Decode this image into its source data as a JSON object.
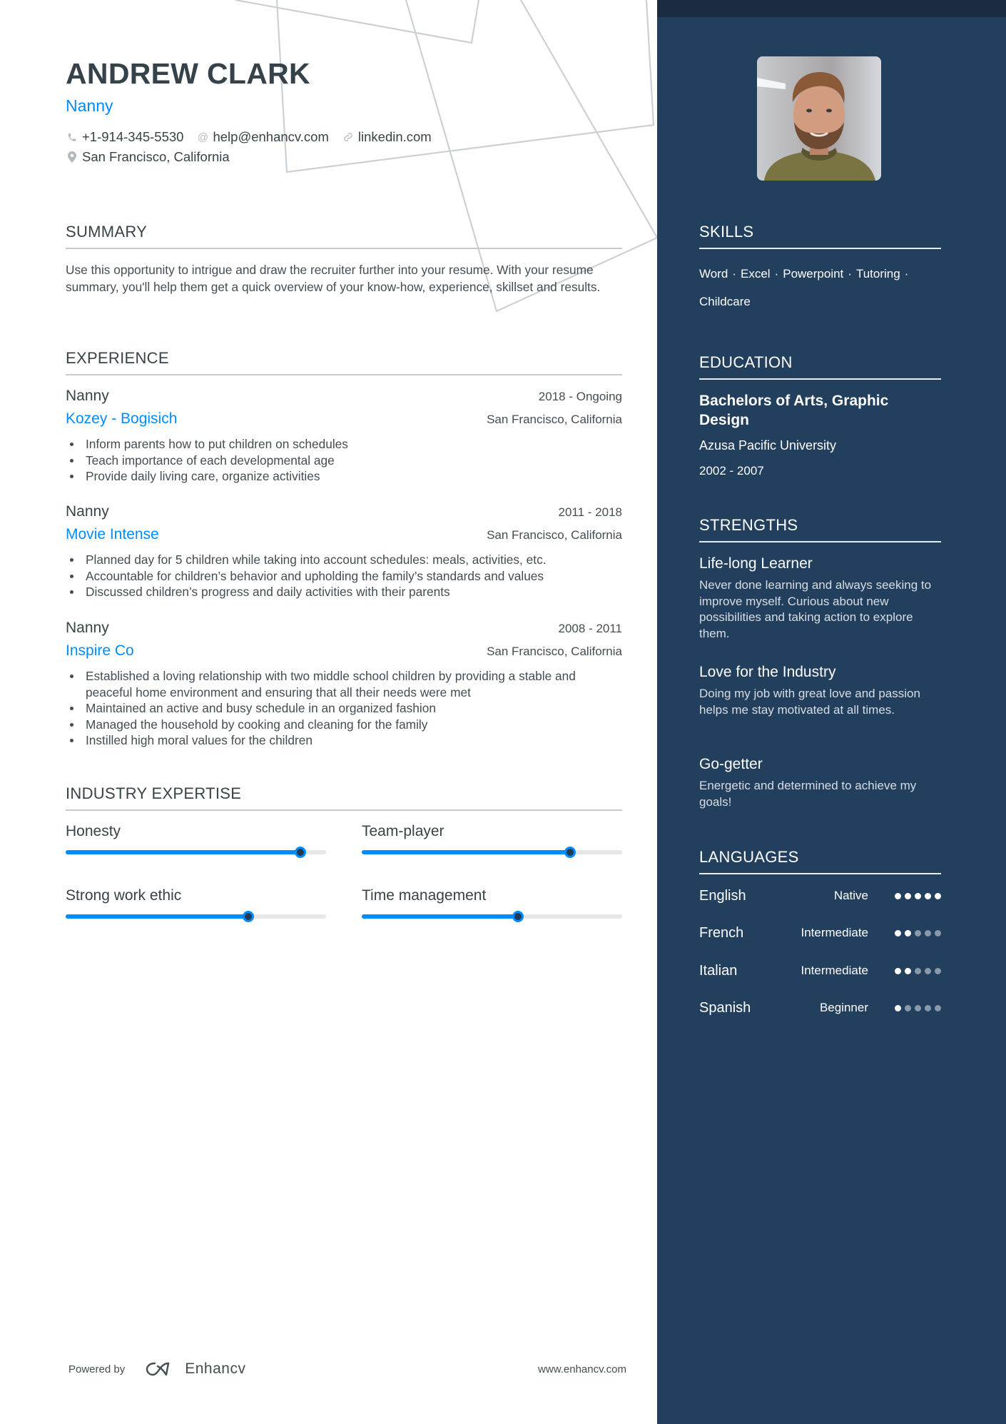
{
  "header": {
    "name": "ANDREW CLARK",
    "title": "Nanny",
    "contacts": [
      {
        "icon": "phone-icon",
        "text": "+1-914-345-5530"
      },
      {
        "icon": "at-icon",
        "text": "help@enhancv.com"
      },
      {
        "icon": "link-icon",
        "text": "linkedin.com"
      }
    ],
    "location": {
      "icon": "location-pin-icon",
      "text": "San Francisco, California"
    }
  },
  "summary": {
    "heading": "SUMMARY",
    "text": "Use this opportunity to intrigue and draw the recruiter further into your resume. With your resume summary, you'll help them get a quick overview of your know-how, experience, skillset and results."
  },
  "experience": {
    "heading": "EXPERIENCE",
    "jobs": [
      {
        "role": "Nanny",
        "dates": "2018 - Ongoing",
        "company": "Kozey - Bogisich",
        "location": "San Francisco, California",
        "bullets": [
          "Inform parents how to put children on schedules",
          "Teach importance of each developmental age",
          "Provide daily living care, organize activities"
        ]
      },
      {
        "role": "Nanny",
        "dates": "2011 - 2018",
        "company": "Movie Intense",
        "location": "San Francisco, California",
        "bullets": [
          "Planned day for 5 children while taking into account schedules: meals, activities, etc.",
          "Accountable for children’s behavior and upholding the family’s standards and values",
          "Discussed children’s progress and daily activities with their parents"
        ]
      },
      {
        "role": "Nanny",
        "dates": "2008 - 2011",
        "company": "Inspire Co",
        "location": "San Francisco, California",
        "bullets": [
          "Established a loving relationship with two middle school children by providing a stable and peaceful home environment and ensuring that all their needs were met",
          "Maintained an active and busy schedule in an organized fashion",
          "Managed the household by cooking and cleaning for the family",
          "Instilled high moral values for the children"
        ]
      }
    ]
  },
  "expertise": {
    "heading": "INDUSTRY EXPERTISE",
    "items": [
      {
        "label": "Honesty",
        "level": 0.9
      },
      {
        "label": "Team-player",
        "level": 0.8
      },
      {
        "label": "Strong work ethic",
        "level": 0.7
      },
      {
        "label": "Time management",
        "level": 0.6
      }
    ]
  },
  "footer": {
    "powered_by": "Powered by",
    "brand": "Enhancv",
    "website": "www.enhancv.com"
  },
  "sidebar": {
    "skills": {
      "heading": "SKILLS",
      "items": [
        "Word",
        "Excel",
        "Powerpoint",
        "Tutoring",
        "Childcare"
      ]
    },
    "education": {
      "heading": "EDUCATION",
      "degree": "Bachelors of Arts, Graphic Design",
      "school": "Azusa Pacific University",
      "years": "2002 - 2007"
    },
    "strengths": {
      "heading": "STRENGTHS",
      "items": [
        {
          "title": "Life-long Learner",
          "description": "Never done learning and always seeking to improve myself. Curious about new possibilities and taking action to explore them."
        },
        {
          "title": "Love for the Industry",
          "description": "Doing my job with great love and passion helps me stay motivated at all times."
        },
        {
          "title": "Go-getter",
          "description": "Energetic and determined to achieve my goals!"
        }
      ]
    },
    "languages": {
      "heading": "LANGUAGES",
      "items": [
        {
          "name": "English",
          "level": "Native",
          "dots": 5
        },
        {
          "name": "French",
          "level": "Intermediate",
          "dots": 2
        },
        {
          "name": "Italian",
          "level": "Intermediate",
          "dots": 2
        },
        {
          "name": "Spanish",
          "level": "Beginner",
          "dots": 1
        }
      ],
      "max_dots": 5
    }
  },
  "colors": {
    "accent": "#008cff",
    "sidebar": "#223f5d",
    "sidebar_top": "#1a2b42",
    "text": "#384347"
  }
}
